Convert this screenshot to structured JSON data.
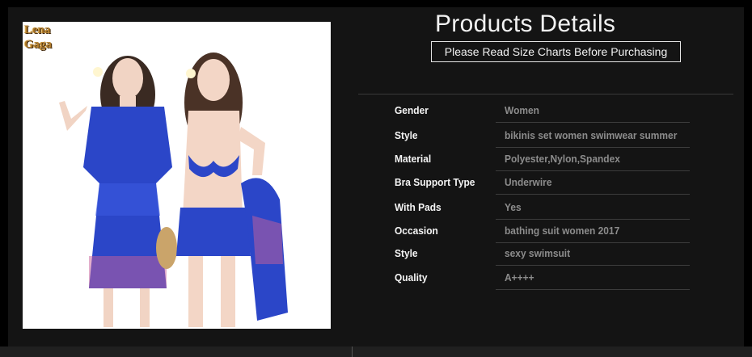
{
  "brand": {
    "line1": "Lena",
    "line2": "Gaga"
  },
  "header": {
    "title": "Products Details",
    "notice": "Please Read Size Charts Before Purchasing"
  },
  "specs": [
    {
      "label": "Gender",
      "value": "Women"
    },
    {
      "label": "Style",
      "value": "bikinis set women swimwear summer"
    },
    {
      "label": "Material",
      "value": "Polyester,Nylon,Spandex"
    },
    {
      "label": "Bra Support Type",
      "value": "Underwire"
    },
    {
      "label": "With Pads",
      "value": "Yes"
    },
    {
      "label": "Occasion",
      "value": "bathing suit women 2017"
    },
    {
      "label": "Style",
      "value": "sexy swimsuit"
    },
    {
      "label": "Quality",
      "value": "A++++"
    }
  ]
}
